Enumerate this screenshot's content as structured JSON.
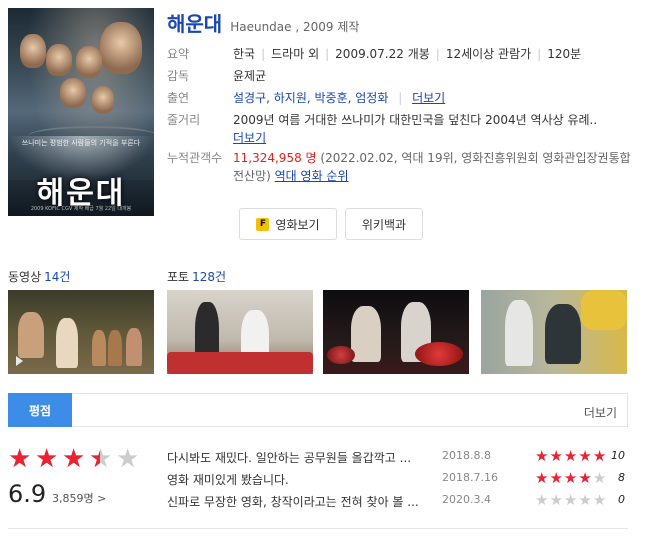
{
  "movie": {
    "title": "해운대",
    "subtitle": "Haeundae , 2009 제작",
    "poster_title": "해운대",
    "poster_tagline": "쓰나미는 평범한 사람들의 기적을 부른다",
    "poster_footer": "2009 KOFIC CGV 제작 배급 7월 22일 대개봉"
  },
  "info": {
    "summary_label": "요약",
    "summary": [
      "한국",
      "드라마 외",
      "2009.07.22 개봉",
      "12세이상 관람가",
      "120분"
    ],
    "director_label": "감독",
    "director": "윤제균",
    "cast_label": "출연",
    "cast": "설경구, 하지원, 박중훈, 엄정화",
    "cast_more": "더보기",
    "plot_label": "줄거리",
    "plot": "2009년 여름 거대한 쓰나미가 대한민국을 덮친다 2004년 역사상 유례..",
    "plot_more": "더보기",
    "audience_label": "누적관객수",
    "audience_count": "11,324,958 명",
    "audience_detail": "(2022.02.02, 역대 19위, 영화진흥위원회 영화관입장권통합전산망)",
    "audience_rank_link": "역대 영화 순위"
  },
  "buttons": {
    "watch_icon": "F",
    "watch": "영화보기",
    "wiki": "위키백과"
  },
  "media": {
    "video_label": "동영상",
    "video_count": "14건",
    "photo_label": "포토",
    "photo_count": "128건"
  },
  "ratings": {
    "tab": "평점",
    "more": "더보기",
    "score": "6.9",
    "score_value": 6.9,
    "score_max": 10,
    "voters": "3,859명 >",
    "reviews": [
      {
        "text": "다시봐도 재밌다. 일안하는 공무원들 올갑깍고 ...",
        "date": "2018.8.8",
        "score": "10",
        "stars": 5
      },
      {
        "text": "영화 재미있게 봤습니다.",
        "date": "2018.7.16",
        "score": "8",
        "stars": 4
      },
      {
        "text": "신파로 무장한 영화, 창작이라고는 전혀 찾아 볼 ...",
        "date": "2020.3.4",
        "score": "0",
        "stars": 0
      }
    ]
  },
  "colors": {
    "link": "#1a47b0",
    "accent_tab": "#3d8de8",
    "star": "#e82334",
    "highlight": "#e0221d"
  }
}
